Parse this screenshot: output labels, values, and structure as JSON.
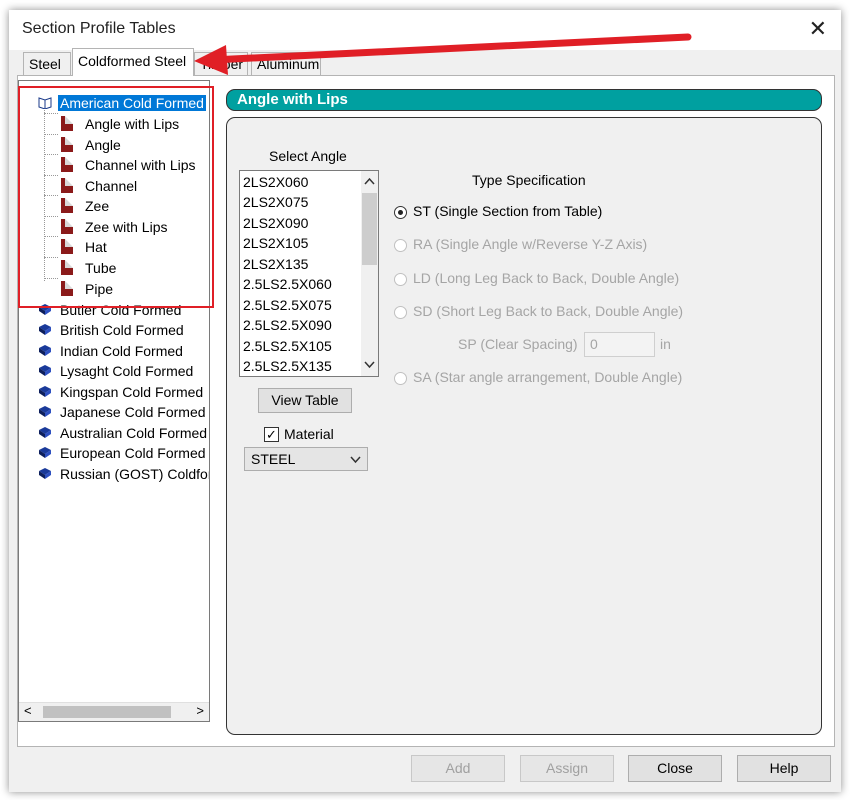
{
  "window": {
    "title": "Section Profile Tables",
    "close_glyph": "✕"
  },
  "tabs": [
    {
      "label": "Steel"
    },
    {
      "label": "Coldformed Steel"
    },
    {
      "label": "Timber"
    },
    {
      "label": "Aluminum"
    }
  ],
  "tree": {
    "root": "American Cold Formed",
    "children": [
      "Angle with Lips",
      "Angle",
      "Channel with Lips",
      "Channel",
      "Zee",
      "Zee with Lips",
      "Hat",
      "Tube",
      "Pipe"
    ],
    "others": [
      "Butler Cold Formed",
      "British Cold Formed",
      "Indian Cold Formed",
      "Lysaght Cold Formed",
      "Kingspan Cold Formed",
      "Japanese Cold Formed",
      "Australian Cold Formed",
      "European Cold Formed",
      "Russian (GOST) Coldform"
    ],
    "scroll_left": "<",
    "scroll_right": ">"
  },
  "section": {
    "header": "Angle with Lips",
    "select_label": "Select Angle",
    "angles": [
      "2LS2X060",
      "2LS2X075",
      "2LS2X090",
      "2LS2X105",
      "2LS2X135",
      "2.5LS2.5X060",
      "2.5LS2.5X075",
      "2.5LS2.5X090",
      "2.5LS2.5X105",
      "2.5LS2.5X135"
    ],
    "view_table": "View Table",
    "material_label": "Material",
    "material_checked": true,
    "material_value": "STEEL"
  },
  "type_spec": {
    "title": "Type Specification",
    "options": [
      {
        "label": "ST (Single Section from Table)",
        "selected": true,
        "enabled": true
      },
      {
        "label": "RA (Single Angle w/Reverse Y-Z Axis)",
        "selected": false,
        "enabled": false
      },
      {
        "label": "LD (Long Leg Back to Back, Double Angle)",
        "selected": false,
        "enabled": false
      },
      {
        "label": "SD (Short Leg Back to Back, Double Angle)",
        "selected": false,
        "enabled": false
      },
      {
        "label": "SA (Star angle arrangement, Double Angle)",
        "selected": false,
        "enabled": false
      }
    ],
    "sp_label": "SP (Clear Spacing)",
    "sp_value": "0",
    "sp_unit": "in"
  },
  "buttons": {
    "add": "Add",
    "assign": "Assign",
    "close": "Close",
    "help": "Help"
  },
  "annotation": {
    "highlight_color": "#e01f26"
  }
}
